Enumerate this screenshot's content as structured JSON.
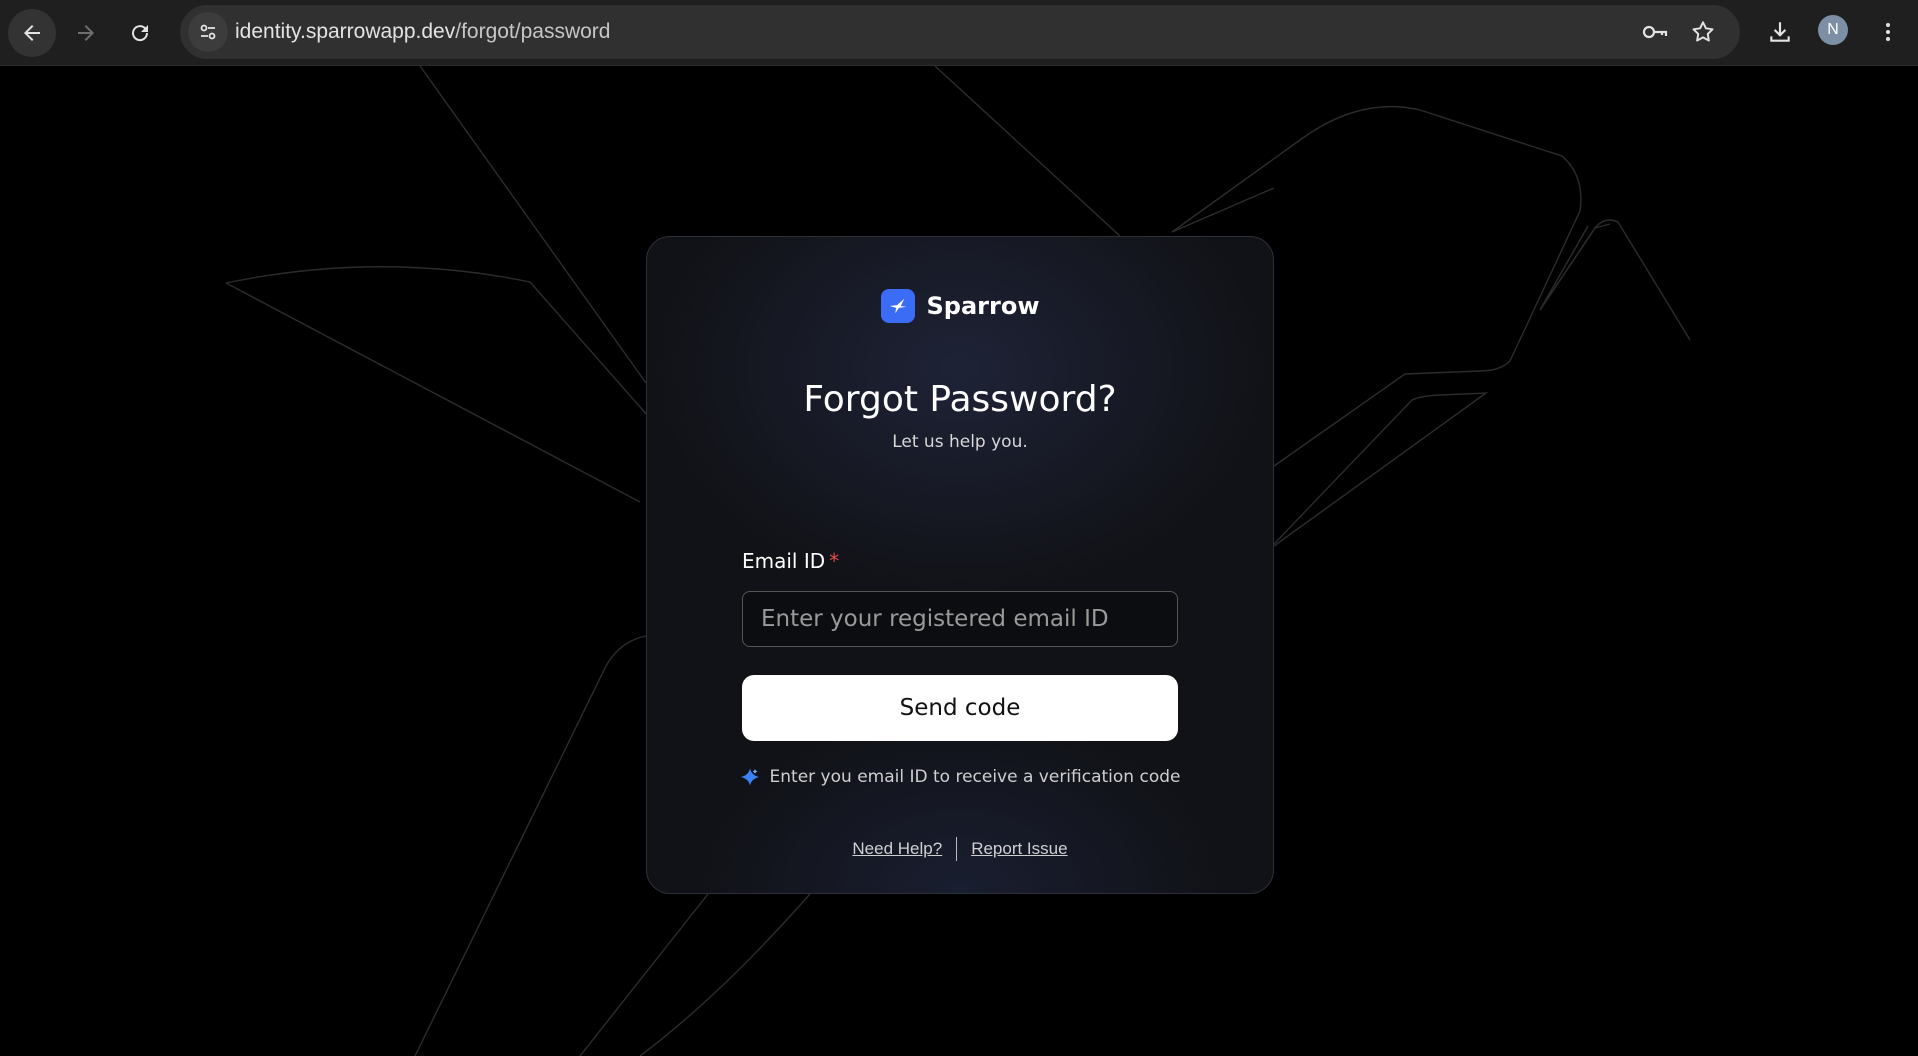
{
  "browser": {
    "url_host": "identity.sparrowapp.dev",
    "url_path": "/forgot/password",
    "profile_initial": "N"
  },
  "brand": {
    "name": "Sparrow",
    "color": "#3b6cf6"
  },
  "form": {
    "title": "Forgot Password?",
    "subtitle": "Let us help you.",
    "email_label": "Email ID",
    "required_marker": "*",
    "email_placeholder": "Enter your registered email ID",
    "email_value": "",
    "submit_label": "Send code",
    "hint": "Enter you email ID to receive a verification code"
  },
  "footer": {
    "help_link": "Need Help?",
    "report_link": "Report Issue"
  }
}
